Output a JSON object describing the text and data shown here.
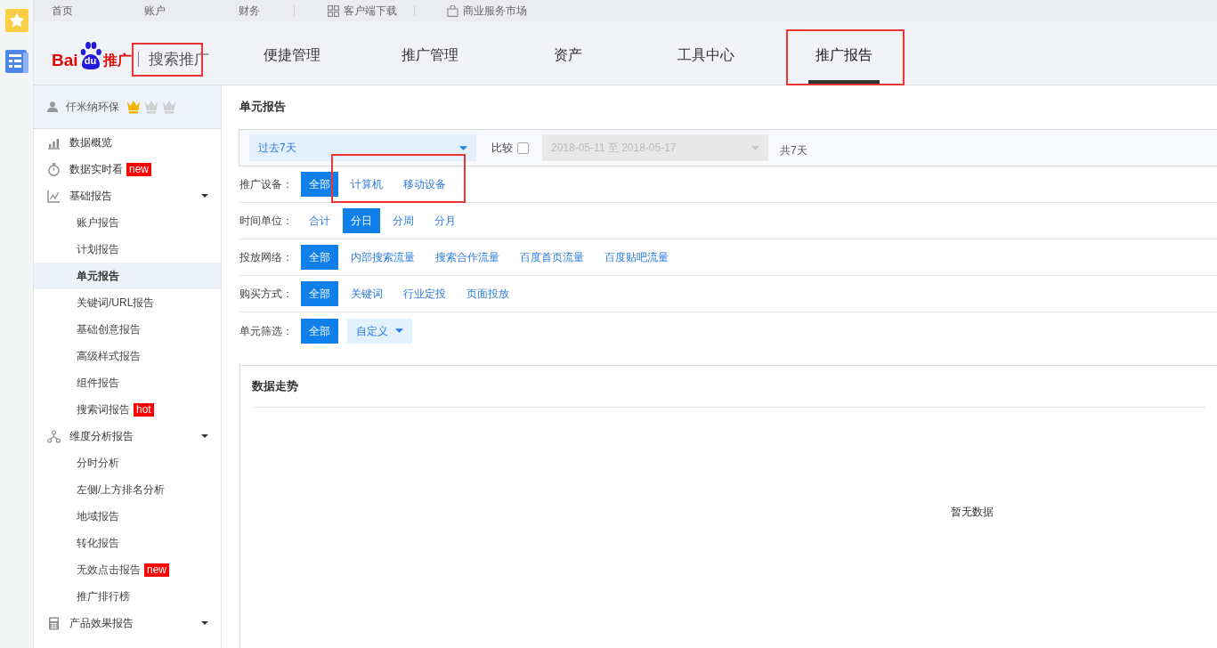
{
  "top_links": [
    {
      "label": "首页"
    },
    {
      "label": "账户"
    },
    {
      "label": "财务"
    },
    {
      "label": "客户端下载"
    },
    {
      "label": "商业服务市场"
    }
  ],
  "brand": {
    "logo_left": "Bai",
    "logo_paw": "du",
    "logo_right": "推广",
    "product": "搜索推广",
    "product_highlighted": true
  },
  "tabs": [
    {
      "label": "便捷管理",
      "selected": false,
      "highlighted": false
    },
    {
      "label": "推广管理",
      "selected": false,
      "highlighted": false
    },
    {
      "label": "资产",
      "selected": false,
      "highlighted": false
    },
    {
      "label": "工具中心",
      "selected": false,
      "highlighted": false
    },
    {
      "label": "推广报告",
      "selected": true,
      "highlighted": true
    }
  ],
  "user": {
    "name": "仟米纳环保",
    "stars": 1
  },
  "sidebar": {
    "items": [
      {
        "label": "数据概览",
        "kind": "link",
        "selected": false
      },
      {
        "label": "数据实时看",
        "kind": "link",
        "tag": "new",
        "selected": false
      },
      {
        "label": "基础报告",
        "kind": "group",
        "selected": false,
        "children": [
          {
            "label": "账户报告",
            "selected": false
          },
          {
            "label": "计划报告",
            "selected": false
          },
          {
            "label": "单元报告",
            "selected": true
          },
          {
            "label": "关键词/URL报告",
            "selected": false
          },
          {
            "label": "基础创意报告",
            "selected": false
          },
          {
            "label": "高级样式报告",
            "selected": false
          },
          {
            "label": "组件报告",
            "selected": false
          },
          {
            "label": "搜索词报告",
            "tag": "hot",
            "selected": false
          }
        ]
      },
      {
        "label": "维度分析报告",
        "kind": "group",
        "selected": false,
        "children": [
          {
            "label": "分时分析",
            "selected": false
          },
          {
            "label": "左侧/上方排名分析",
            "selected": false
          },
          {
            "label": "地域报告",
            "selected": false
          },
          {
            "label": "转化报告",
            "selected": false
          },
          {
            "label": "无效点击报告",
            "tag": "new",
            "selected": false
          },
          {
            "label": "推广排行榜",
            "selected": false
          }
        ]
      },
      {
        "label": "产品效果报告",
        "kind": "group",
        "selected": false
      }
    ]
  },
  "page_title": "单元报告",
  "date_bar": {
    "range": "过去7天",
    "compare_label": "比较",
    "compare_checked": false,
    "compare_range": "2018-05-11 至 2018-05-17",
    "compare_disabled": true,
    "total": "共7天"
  },
  "filters": [
    {
      "label": "推广设备：",
      "highlighted": true,
      "options": [
        {
          "label": "全部",
          "selected": true
        },
        {
          "label": "计算机",
          "selected": false
        },
        {
          "label": "移动设备",
          "selected": false
        }
      ]
    },
    {
      "label": "时间单位：",
      "highlighted": false,
      "options": [
        {
          "label": "合计",
          "selected": false
        },
        {
          "label": "分日",
          "selected": true
        },
        {
          "label": "分周",
          "selected": false
        },
        {
          "label": "分月",
          "selected": false
        }
      ]
    },
    {
      "label": "投放网络：",
      "highlighted": false,
      "options": [
        {
          "label": "全部",
          "selected": true
        },
        {
          "label": "内部搜索流量",
          "selected": false
        },
        {
          "label": "搜索合作流量",
          "selected": false
        },
        {
          "label": "百度首页流量",
          "selected": false
        },
        {
          "label": "百度贴吧流量",
          "selected": false
        }
      ]
    },
    {
      "label": "购买方式：",
      "highlighted": false,
      "options": [
        {
          "label": "全部",
          "selected": true
        },
        {
          "label": "关键词",
          "selected": false
        },
        {
          "label": "行业定投",
          "selected": false
        },
        {
          "label": "页面投放",
          "selected": false
        }
      ]
    },
    {
      "label": "单元筛选：",
      "highlighted": false,
      "options": [
        {
          "label": "全部",
          "selected": true
        }
      ],
      "dropdown": "自定义"
    }
  ],
  "trend_panel": {
    "title": "数据走势",
    "empty_text": "暂无数据"
  }
}
